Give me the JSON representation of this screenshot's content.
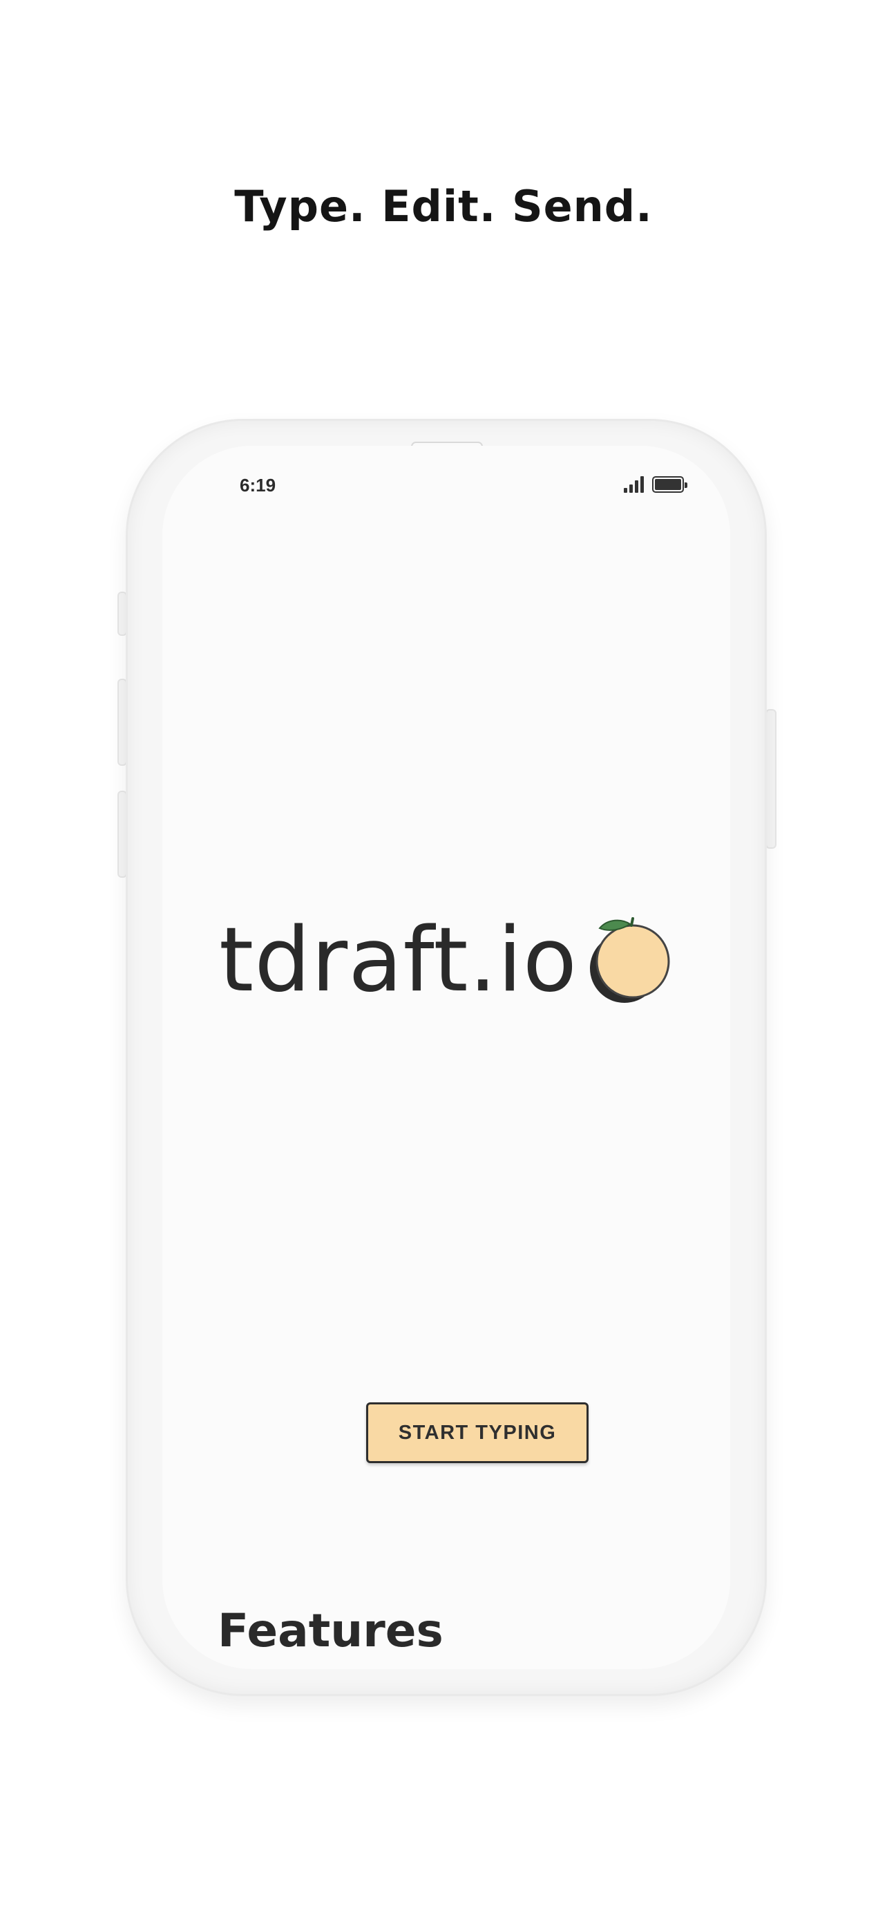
{
  "headline": "Type. Edit. Send.",
  "status_bar": {
    "time": "6:19",
    "icons": [
      "signal-icon",
      "battery-icon"
    ]
  },
  "brand": {
    "name": "tdraft.io",
    "logo_icon": "orange-fruit-icon"
  },
  "cta": {
    "label": "START TYPING"
  },
  "sections": {
    "features_title": "Features"
  },
  "colors": {
    "button_bg": "#f9d9a4",
    "orange_fill": "#f9d9a4",
    "leaf": "#4c8a4e",
    "text_dark": "#2a2a2a"
  }
}
